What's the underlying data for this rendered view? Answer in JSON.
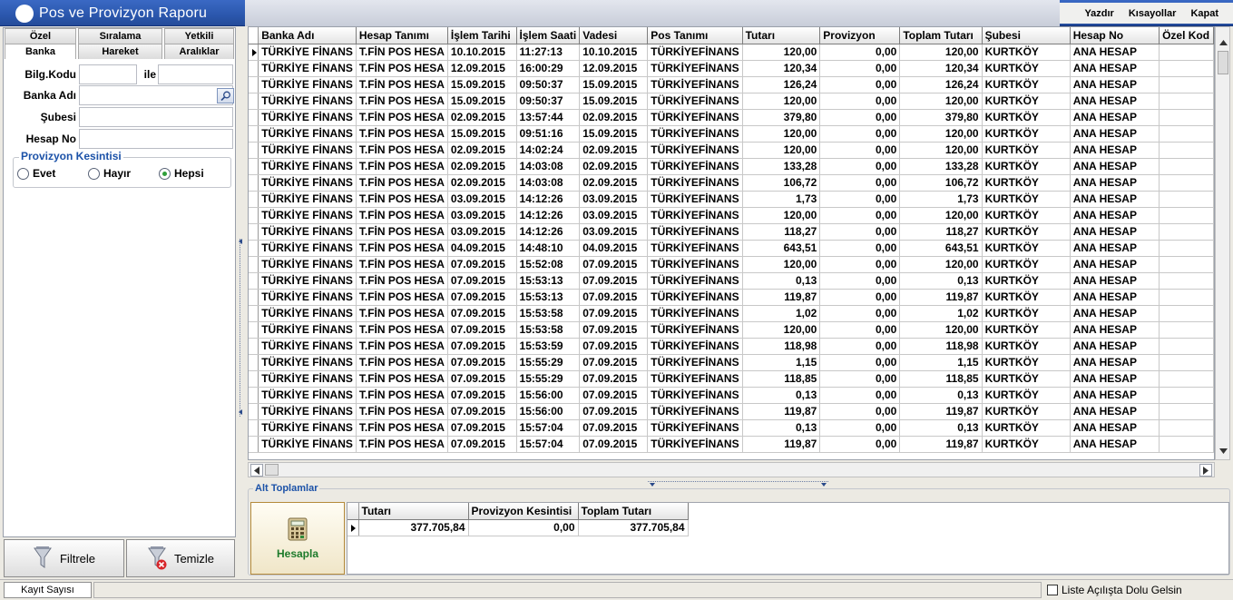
{
  "window": {
    "title": "Pos ve Provizyon Raporu"
  },
  "menu": {
    "print": "Yazdır",
    "shortcuts": "Kısayollar",
    "close": "Kapat"
  },
  "tabs": {
    "ozel": "Özel",
    "siralama": "Sıralama",
    "yetkili": "Yetkili",
    "banka": "Banka",
    "hareket": "Hareket",
    "araliklar": "Aralıklar"
  },
  "filters": {
    "bilg_kodu": "Bilg.Kodu",
    "ile": "ile",
    "banka_adi": "Banka Adı",
    "subesi": "Şubesi",
    "hesap_no": "Hesap No",
    "provizyon_title": "Provizyon Kesintisi",
    "evet": "Evet",
    "hayir": "Hayır",
    "hepsi": "Hepsi",
    "selected": "hepsi"
  },
  "buttons": {
    "filtrele": "Filtrele",
    "temizle": "Temizle",
    "hesapla": "Hesapla"
  },
  "grid": {
    "columns": [
      "Banka Adı",
      "Hesap Tanımı",
      "İşlem Tarihi",
      "İşlem Saati",
      "Vadesi",
      "Pos Tanımı",
      "Tutarı",
      "Provizyon",
      "Toplam Tutarı",
      "Şubesi",
      "Hesap No",
      "Özel Kod"
    ],
    "rows": [
      [
        "TÜRKİYE FİNANS",
        "T.FİN POS HESA",
        "10.10.2015",
        "11:27:13",
        "10.10.2015",
        "TÜRKİYEFİNANS",
        "120,00",
        "0,00",
        "120,00",
        "KURTKÖY",
        "ANA HESAP",
        ""
      ],
      [
        "TÜRKİYE FİNANS",
        "T.FİN POS HESA",
        "12.09.2015",
        "16:00:29",
        "12.09.2015",
        "TÜRKİYEFİNANS",
        "120,34",
        "0,00",
        "120,34",
        "KURTKÖY",
        "ANA HESAP",
        ""
      ],
      [
        "TÜRKİYE FİNANS",
        "T.FİN POS HESA",
        "15.09.2015",
        "09:50:37",
        "15.09.2015",
        "TÜRKİYEFİNANS",
        "126,24",
        "0,00",
        "126,24",
        "KURTKÖY",
        "ANA HESAP",
        ""
      ],
      [
        "TÜRKİYE FİNANS",
        "T.FİN POS HESA",
        "15.09.2015",
        "09:50:37",
        "15.09.2015",
        "TÜRKİYEFİNANS",
        "120,00",
        "0,00",
        "120,00",
        "KURTKÖY",
        "ANA HESAP",
        ""
      ],
      [
        "TÜRKİYE FİNANS",
        "T.FİN POS HESA",
        "02.09.2015",
        "13:57:44",
        "02.09.2015",
        "TÜRKİYEFİNANS",
        "379,80",
        "0,00",
        "379,80",
        "KURTKÖY",
        "ANA HESAP",
        ""
      ],
      [
        "TÜRKİYE FİNANS",
        "T.FİN POS HESA",
        "15.09.2015",
        "09:51:16",
        "15.09.2015",
        "TÜRKİYEFİNANS",
        "120,00",
        "0,00",
        "120,00",
        "KURTKÖY",
        "ANA HESAP",
        ""
      ],
      [
        "TÜRKİYE FİNANS",
        "T.FİN POS HESA",
        "02.09.2015",
        "14:02:24",
        "02.09.2015",
        "TÜRKİYEFİNANS",
        "120,00",
        "0,00",
        "120,00",
        "KURTKÖY",
        "ANA HESAP",
        ""
      ],
      [
        "TÜRKİYE FİNANS",
        "T.FİN POS HESA",
        "02.09.2015",
        "14:03:08",
        "02.09.2015",
        "TÜRKİYEFİNANS",
        "133,28",
        "0,00",
        "133,28",
        "KURTKÖY",
        "ANA HESAP",
        ""
      ],
      [
        "TÜRKİYE FİNANS",
        "T.FİN POS HESA",
        "02.09.2015",
        "14:03:08",
        "02.09.2015",
        "TÜRKİYEFİNANS",
        "106,72",
        "0,00",
        "106,72",
        "KURTKÖY",
        "ANA HESAP",
        ""
      ],
      [
        "TÜRKİYE FİNANS",
        "T.FİN POS HESA",
        "03.09.2015",
        "14:12:26",
        "03.09.2015",
        "TÜRKİYEFİNANS",
        "1,73",
        "0,00",
        "1,73",
        "KURTKÖY",
        "ANA HESAP",
        ""
      ],
      [
        "TÜRKİYE FİNANS",
        "T.FİN POS HESA",
        "03.09.2015",
        "14:12:26",
        "03.09.2015",
        "TÜRKİYEFİNANS",
        "120,00",
        "0,00",
        "120,00",
        "KURTKÖY",
        "ANA HESAP",
        ""
      ],
      [
        "TÜRKİYE FİNANS",
        "T.FİN POS HESA",
        "03.09.2015",
        "14:12:26",
        "03.09.2015",
        "TÜRKİYEFİNANS",
        "118,27",
        "0,00",
        "118,27",
        "KURTKÖY",
        "ANA HESAP",
        ""
      ],
      [
        "TÜRKİYE FİNANS",
        "T.FİN POS HESA",
        "04.09.2015",
        "14:48:10",
        "04.09.2015",
        "TÜRKİYEFİNANS",
        "643,51",
        "0,00",
        "643,51",
        "KURTKÖY",
        "ANA HESAP",
        ""
      ],
      [
        "TÜRKİYE FİNANS",
        "T.FİN POS HESA",
        "07.09.2015",
        "15:52:08",
        "07.09.2015",
        "TÜRKİYEFİNANS",
        "120,00",
        "0,00",
        "120,00",
        "KURTKÖY",
        "ANA HESAP",
        ""
      ],
      [
        "TÜRKİYE FİNANS",
        "T.FİN POS HESA",
        "07.09.2015",
        "15:53:13",
        "07.09.2015",
        "TÜRKİYEFİNANS",
        "0,13",
        "0,00",
        "0,13",
        "KURTKÖY",
        "ANA HESAP",
        ""
      ],
      [
        "TÜRKİYE FİNANS",
        "T.FİN POS HESA",
        "07.09.2015",
        "15:53:13",
        "07.09.2015",
        "TÜRKİYEFİNANS",
        "119,87",
        "0,00",
        "119,87",
        "KURTKÖY",
        "ANA HESAP",
        ""
      ],
      [
        "TÜRKİYE FİNANS",
        "T.FİN POS HESA",
        "07.09.2015",
        "15:53:58",
        "07.09.2015",
        "TÜRKİYEFİNANS",
        "1,02",
        "0,00",
        "1,02",
        "KURTKÖY",
        "ANA HESAP",
        ""
      ],
      [
        "TÜRKİYE FİNANS",
        "T.FİN POS HESA",
        "07.09.2015",
        "15:53:58",
        "07.09.2015",
        "TÜRKİYEFİNANS",
        "120,00",
        "0,00",
        "120,00",
        "KURTKÖY",
        "ANA HESAP",
        ""
      ],
      [
        "TÜRKİYE FİNANS",
        "T.FİN POS HESA",
        "07.09.2015",
        "15:53:59",
        "07.09.2015",
        "TÜRKİYEFİNANS",
        "118,98",
        "0,00",
        "118,98",
        "KURTKÖY",
        "ANA HESAP",
        ""
      ],
      [
        "TÜRKİYE FİNANS",
        "T.FİN POS HESA",
        "07.09.2015",
        "15:55:29",
        "07.09.2015",
        "TÜRKİYEFİNANS",
        "1,15",
        "0,00",
        "1,15",
        "KURTKÖY",
        "ANA HESAP",
        ""
      ],
      [
        "TÜRKİYE FİNANS",
        "T.FİN POS HESA",
        "07.09.2015",
        "15:55:29",
        "07.09.2015",
        "TÜRKİYEFİNANS",
        "118,85",
        "0,00",
        "118,85",
        "KURTKÖY",
        "ANA HESAP",
        ""
      ],
      [
        "TÜRKİYE FİNANS",
        "T.FİN POS HESA",
        "07.09.2015",
        "15:56:00",
        "07.09.2015",
        "TÜRKİYEFİNANS",
        "0,13",
        "0,00",
        "0,13",
        "KURTKÖY",
        "ANA HESAP",
        ""
      ],
      [
        "TÜRKİYE FİNANS",
        "T.FİN POS HESA",
        "07.09.2015",
        "15:56:00",
        "07.09.2015",
        "TÜRKİYEFİNANS",
        "119,87",
        "0,00",
        "119,87",
        "KURTKÖY",
        "ANA HESAP",
        ""
      ],
      [
        "TÜRKİYE FİNANS",
        "T.FİN POS HESA",
        "07.09.2015",
        "15:57:04",
        "07.09.2015",
        "TÜRKİYEFİNANS",
        "0,13",
        "0,00",
        "0,13",
        "KURTKÖY",
        "ANA HESAP",
        ""
      ],
      [
        "TÜRKİYE FİNANS",
        "T.FİN POS HESA",
        "07.09.2015",
        "15:57:04",
        "07.09.2015",
        "TÜRKİYEFİNANS",
        "119,87",
        "0,00",
        "119,87",
        "KURTKÖY",
        "ANA HESAP",
        ""
      ]
    ]
  },
  "subtotals": {
    "title": "Alt Toplamlar",
    "columns": [
      "Tutarı",
      "Provizyon Kesintisi",
      "Toplam Tutarı"
    ],
    "values": [
      "377.705,84",
      "0,00",
      "377.705,84"
    ]
  },
  "status": {
    "kayit_sayisi": "Kayıt Sayısı",
    "liste_checkbox": "Liste Açılışta Dolu Gelsin"
  }
}
